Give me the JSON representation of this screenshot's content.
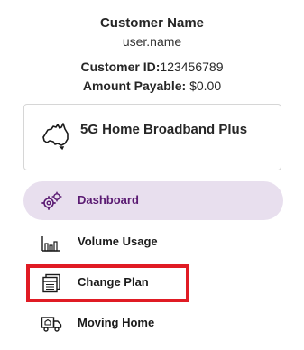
{
  "customer": {
    "name": "Customer Name",
    "username": "user.name",
    "id_label": "Customer ID:",
    "id_value": "123456789",
    "amount_label": "Amount Payable:",
    "amount_value": "$0.00"
  },
  "plan": {
    "name": "5G Home Broadband Plus",
    "icon": "australia-map-icon"
  },
  "nav": {
    "items": [
      {
        "label": "Dashboard",
        "icon": "gears-icon",
        "active": true
      },
      {
        "label": "Volume Usage",
        "icon": "bar-chart-icon",
        "active": false
      },
      {
        "label": "Change Plan",
        "icon": "plan-document-icon",
        "active": false
      },
      {
        "label": "Moving Home",
        "icon": "moving-truck-icon",
        "active": false
      }
    ]
  },
  "colors": {
    "active_bg": "#e8dfee",
    "active_text": "#5a1a72",
    "highlight": "#e01b24",
    "card_border": "#d6d6d6"
  }
}
